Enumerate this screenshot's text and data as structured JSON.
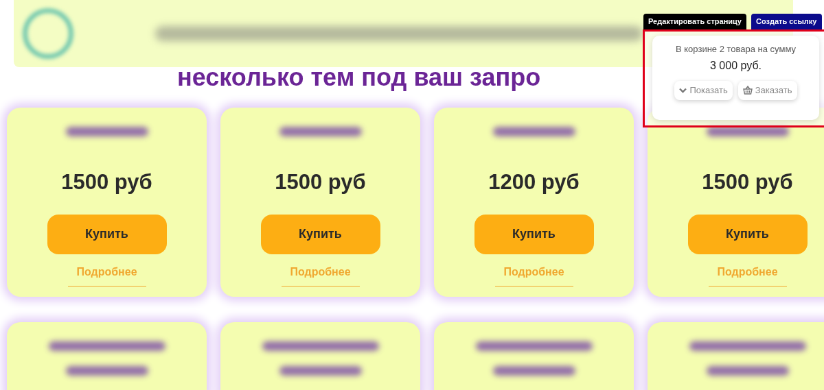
{
  "heading": "несколько тем под ваш запро",
  "toolbar": [
    {
      "label": "Редактировать страницу",
      "kind": "edit"
    },
    {
      "label": "Создать ссылку",
      "kind": "link"
    }
  ],
  "cart": {
    "summary": "В корзине 2 товара на сумму",
    "total": "3 000 руб.",
    "buttons": [
      {
        "label": "Показать",
        "kind": "show"
      },
      {
        "label": "Заказать",
        "kind": "order"
      }
    ]
  },
  "cards": [
    {
      "price": "1500 руб",
      "buy": "Купить",
      "details": "Подробнее"
    },
    {
      "price": "1500 руб",
      "buy": "Купить",
      "details": "Подробнее"
    },
    {
      "price": "1200 руб",
      "buy": "Купить",
      "details": "Подробнее"
    },
    {
      "price": "1500 руб",
      "buy": "Купить",
      "details": "Подробнее"
    }
  ],
  "lower_cards": [
    {
      "kind": "redacted"
    },
    {
      "kind": "redacted"
    },
    {
      "kind": "redacted"
    },
    {
      "kind": "redacted"
    }
  ]
}
